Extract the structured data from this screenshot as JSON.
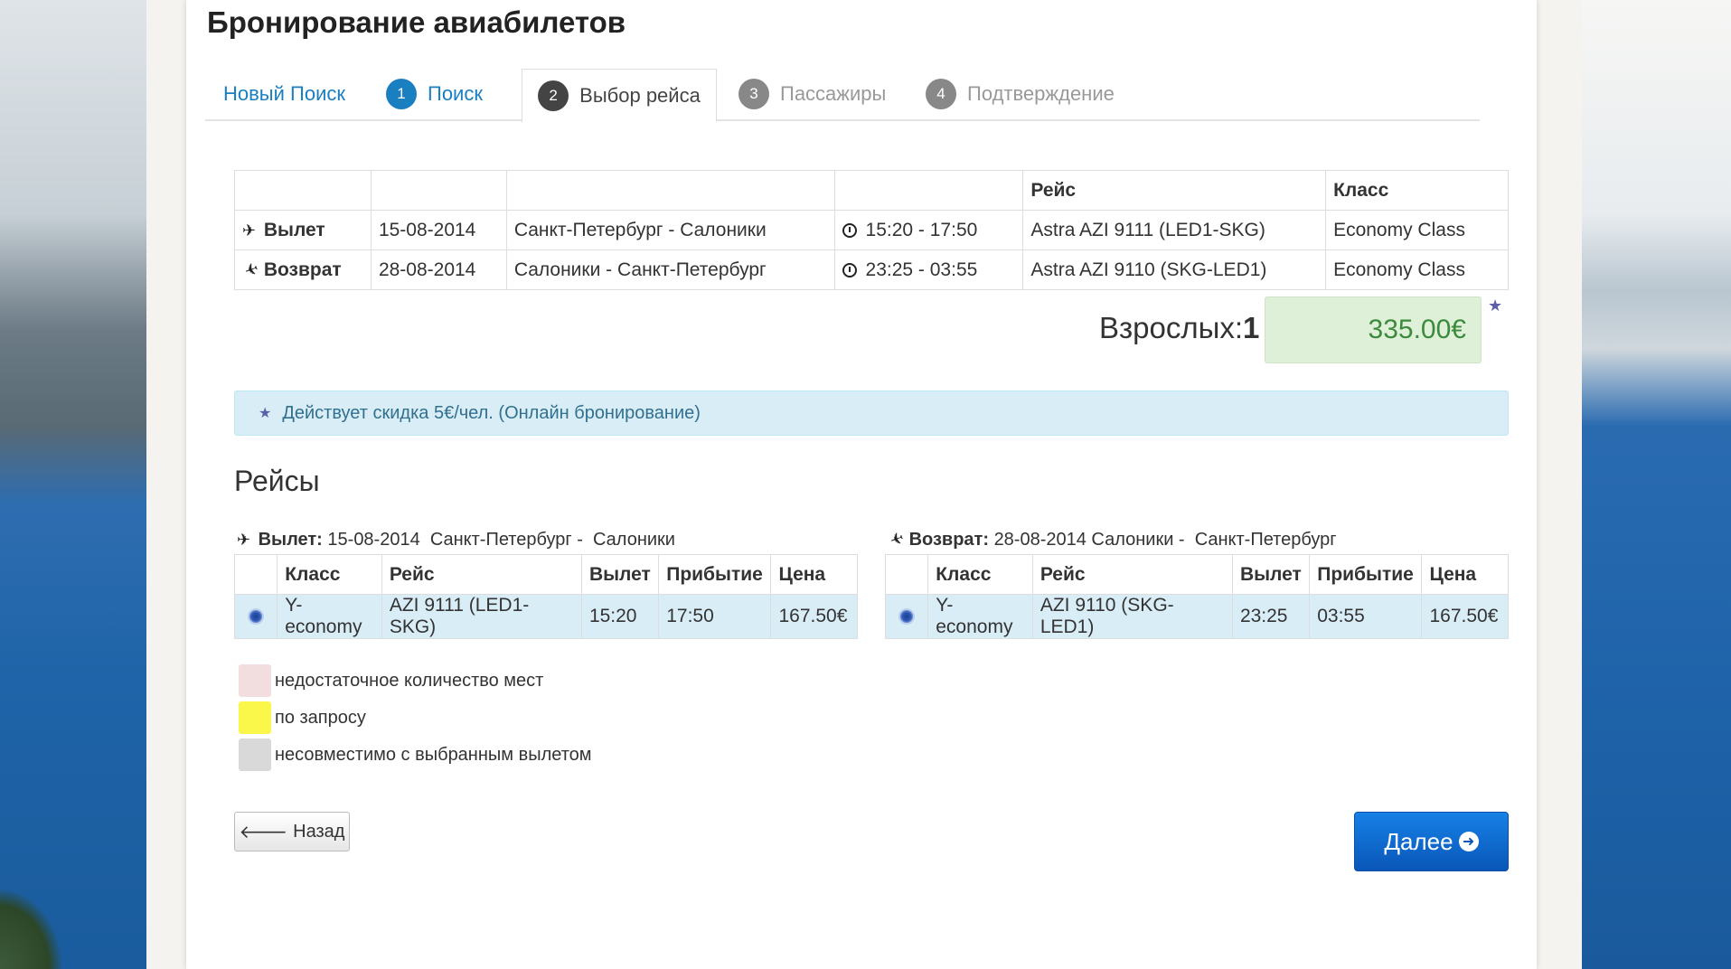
{
  "page_title": "Бронирование авиабилетов",
  "tabs": {
    "new_search": "Новый Поиск",
    "steps": [
      {
        "num": "1",
        "label": "Поиск"
      },
      {
        "num": "2",
        "label": "Выбор рейса"
      },
      {
        "num": "3",
        "label": "Пассажиры"
      },
      {
        "num": "4",
        "label": "Подтверждение"
      }
    ]
  },
  "summary": {
    "headers": [
      "",
      "",
      "",
      "",
      "Рейс",
      "Класс"
    ],
    "rows": [
      {
        "direction": "Вылет",
        "date": "15-08-2014",
        "route": "Санкт-Петербург - Салоники",
        "time": "15:20 - 17:50",
        "flight": "Astra AZI 9111 (LED1-SKG)",
        "class": "Economy Class"
      },
      {
        "direction": "Возврат",
        "date": "28-08-2014",
        "route": "Салоники - Санкт-Петербург",
        "time": "23:25 - 03:55",
        "flight": "Astra AZI 9110 (SKG-LED1)",
        "class": "Economy Class"
      }
    ]
  },
  "passengers": {
    "label": "Взрослых:",
    "count": "1"
  },
  "total_price": "335.00€",
  "discount_notice": "Действует скидка 5€/чел. (Онлайн бронирование)",
  "flights_title": "Рейсы",
  "legs": {
    "outbound": {
      "label": "Вылет:",
      "info": "15-08-2014  Санкт-Петербург -  Салоники",
      "headers": [
        "",
        "Класс",
        "Рейс",
        "Вылет",
        "Прибытие",
        "Цена"
      ],
      "row": {
        "class": "Y-economy",
        "flight": "AZI 9111 (LED1-SKG)",
        "dep": "15:20",
        "arr": "17:50",
        "price": "167.50€"
      }
    },
    "return": {
      "label": "Возврат:",
      "info": "28-08-2014 Салоники -  Санкт-Петербург",
      "headers": [
        "",
        "Класс",
        "Рейс",
        "Вылет",
        "Прибытие",
        "Цена"
      ],
      "row": {
        "class": "Y-economy",
        "flight": "AZI 9110 (SKG-LED1)",
        "dep": "23:25",
        "arr": "03:55",
        "price": "167.50€"
      }
    }
  },
  "legend": [
    {
      "label": "недостаточное количество мест",
      "color": "#f2dede"
    },
    {
      "label": "по запросу",
      "color": "#fbf74a"
    },
    {
      "label": "несовместимо с выбранным вылетом",
      "color": "#d9d9d9"
    }
  ],
  "buttons": {
    "back": "Назад",
    "next": "Далее"
  },
  "colors": {
    "link": "#1a7fc1",
    "price_bg": "#dff0d8",
    "price_text": "#3c8a3e",
    "info_bg": "#d9edf7",
    "primary": "#0a56b8"
  },
  "icons": {
    "departure": "plane-takeoff-icon",
    "return": "plane-landing-icon",
    "time": "clock-icon",
    "discount": "star-icon"
  }
}
